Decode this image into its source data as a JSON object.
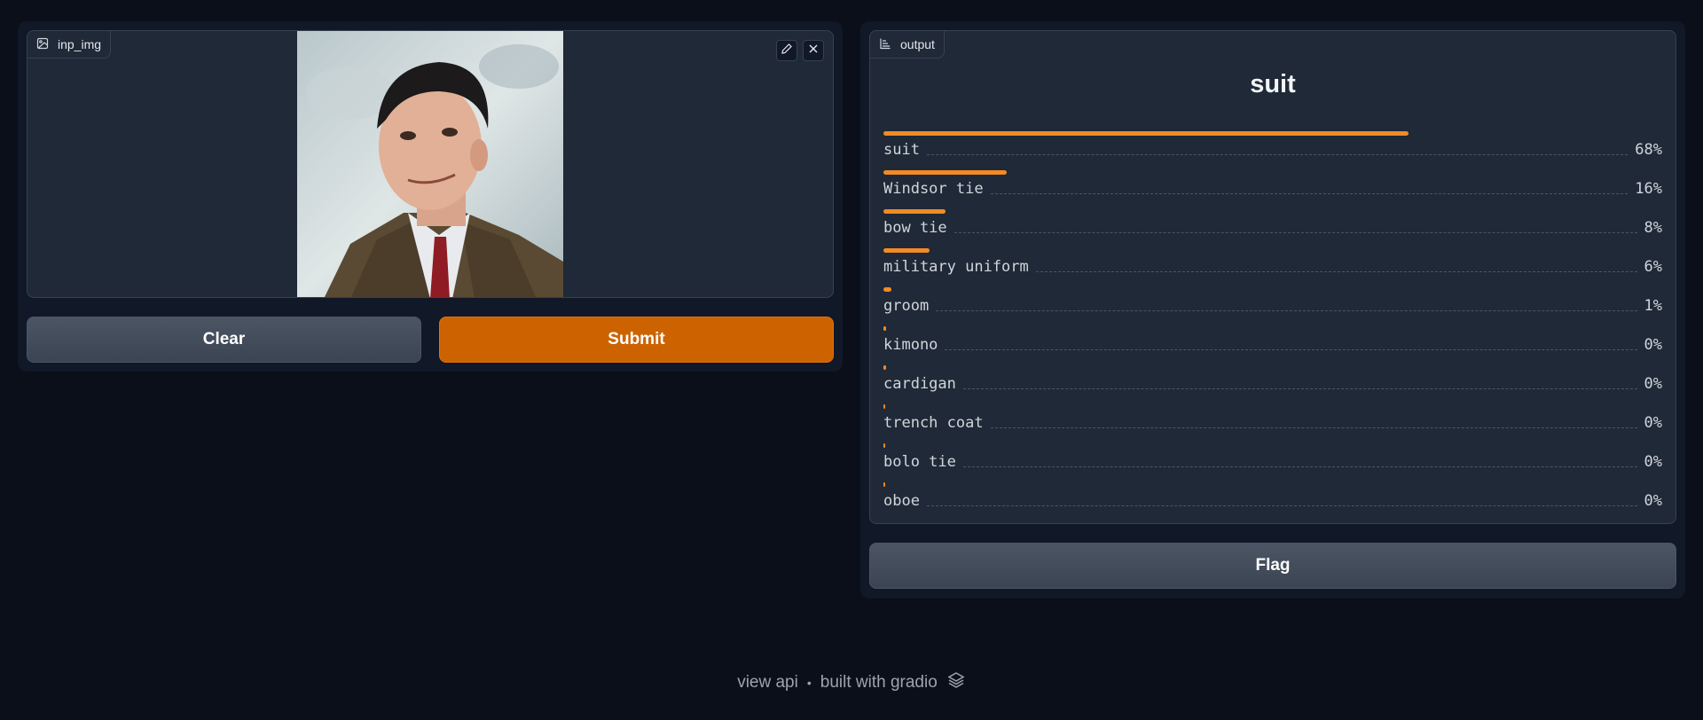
{
  "input": {
    "label": "inp_img",
    "clear_label": "Clear",
    "submit_label": "Submit"
  },
  "output": {
    "label": "output",
    "top_label": "suit",
    "confidences": [
      {
        "label": "suit",
        "pct": "68%",
        "value": 0.68
      },
      {
        "label": "Windsor tie",
        "pct": "16%",
        "value": 0.16
      },
      {
        "label": "bow tie",
        "pct": "8%",
        "value": 0.08
      },
      {
        "label": "military uniform",
        "pct": "6%",
        "value": 0.06
      },
      {
        "label": "groom",
        "pct": "1%",
        "value": 0.01
      },
      {
        "label": "kimono",
        "pct": "0%",
        "value": 0.003
      },
      {
        "label": "cardigan",
        "pct": "0%",
        "value": 0.003
      },
      {
        "label": "trench coat",
        "pct": "0%",
        "value": 0.002
      },
      {
        "label": "bolo tie",
        "pct": "0%",
        "value": 0.002
      },
      {
        "label": "oboe",
        "pct": "0%",
        "value": 0.002
      }
    ],
    "flag_label": "Flag"
  },
  "footer": {
    "view_api": "view api",
    "separator": "•",
    "built_with": "built with gradio"
  },
  "colors": {
    "background": "#0b0f19",
    "panel": "#111827",
    "block": "#1f2937",
    "primary": "#cc6300",
    "bar": "#f28b24"
  },
  "icons": [
    "image-icon",
    "edit-icon",
    "close-icon",
    "label-icon",
    "gradio-logo-icon"
  ]
}
